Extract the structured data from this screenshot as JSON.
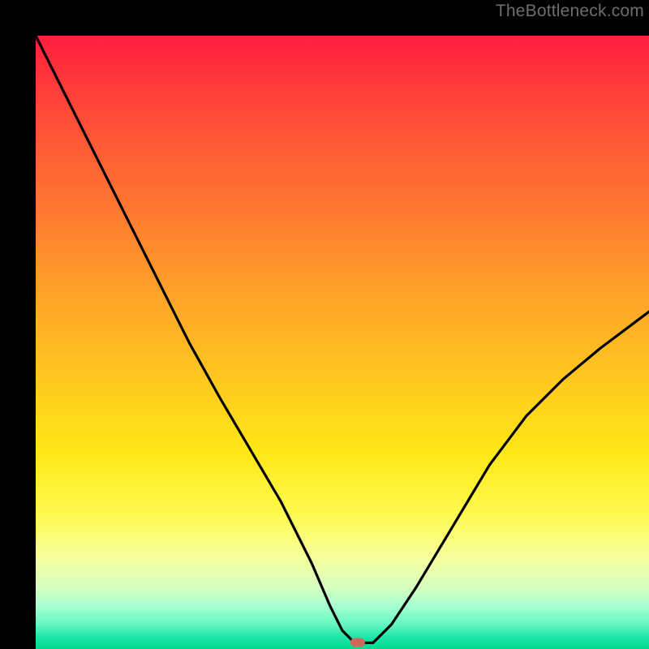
{
  "watermark": "TheBottleneck.com",
  "marker": {
    "x_pct": 52.5,
    "y_pct": 99.0
  },
  "colors": {
    "top": "#ff1d3f",
    "mid": "#ffe716",
    "bottom": "#00d98e",
    "curve": "#000000",
    "marker": "#cf695c",
    "watermark": "#6d6d6d",
    "frame": "#000000"
  },
  "chart_data": {
    "type": "line",
    "title": "",
    "xlabel": "",
    "ylabel": "",
    "xlim": [
      0,
      100
    ],
    "ylim": [
      0,
      100
    ],
    "grid": false,
    "note": "Axes show percentage position; y is bottleneck % (0=green, 100=red). Values estimated from pixels.",
    "series": [
      {
        "name": "bottleneck-curve",
        "x": [
          0,
          5,
          10,
          15,
          20,
          25,
          30,
          35,
          40,
          45,
          48,
          50,
          52,
          55,
          58,
          62,
          68,
          74,
          80,
          86,
          92,
          100
        ],
        "y": [
          100,
          90,
          80,
          70,
          60,
          50,
          41,
          32.5,
          24,
          14,
          7,
          3,
          1,
          1,
          4,
          10,
          20,
          30,
          38,
          44,
          49,
          55
        ]
      }
    ],
    "marker_point": {
      "x": 52.5,
      "y": 1
    }
  }
}
